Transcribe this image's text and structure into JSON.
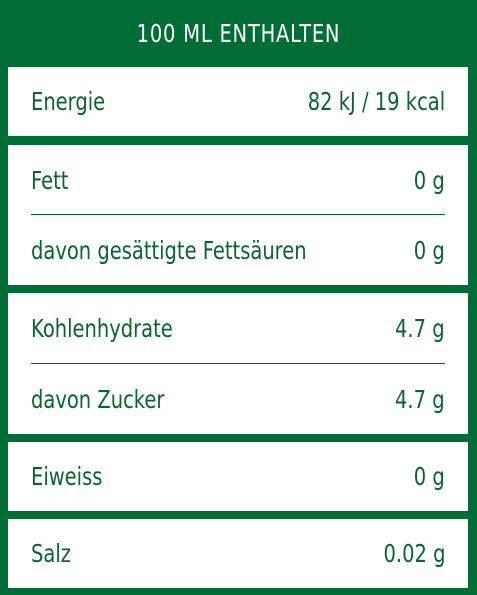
{
  "header": {
    "title": "100 ML ENTHALTEN"
  },
  "nutrition": {
    "energy": {
      "label": "Energie",
      "value": "82 kJ / 19 kcal"
    },
    "fat": {
      "label": "Fett",
      "value": "0 g"
    },
    "saturated_fat": {
      "label": "davon gesättigte Fettsäuren",
      "value": "0 g"
    },
    "carbohydrates": {
      "label": "Kohlenhydrate",
      "value": "4.7 g"
    },
    "sugar": {
      "label": "davon Zucker",
      "value": "4.7 g"
    },
    "protein": {
      "label": "Eiweiss",
      "value": "0 g"
    },
    "salt": {
      "label": "Salz",
      "value": "0.02 g"
    }
  },
  "colors": {
    "brand_green": "#006d36",
    "text_green": "#0a6430",
    "panel": "#ffffff"
  }
}
